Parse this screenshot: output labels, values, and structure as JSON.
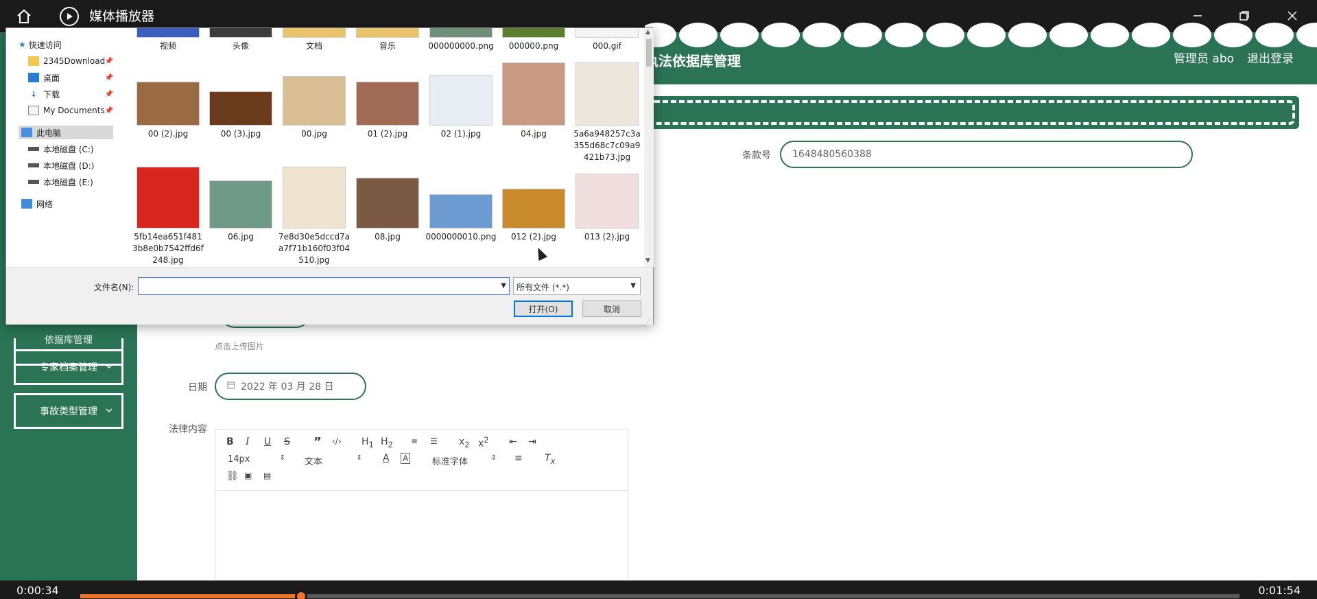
{
  "player": {
    "title": "媒体播放器",
    "time_current": "0:00:34",
    "time_total": "0:01:54",
    "progress_fraction": 0.1905
  },
  "app": {
    "title_partial": "执法依据库管理",
    "user": "管理员 abo",
    "logout": "退出登录",
    "sidebar": [
      {
        "label": "依据库管理",
        "has_chevron": false
      },
      {
        "label": "专家档案管理",
        "has_chevron": true
      },
      {
        "label": "事故类型管理",
        "has_chevron": true
      }
    ],
    "form": {
      "clause_label": "条款号",
      "clause_value": "1648480560388",
      "upload_hint": "点击上传图片",
      "date_label": "日期",
      "date_value": "2022 年 03 月 28 日",
      "content_label": "法律内容"
    },
    "editor": {
      "font_size": "14px",
      "block_type": "文本",
      "font_family": "标准字体"
    }
  },
  "dialog": {
    "nav": {
      "quick_access": "快速访问",
      "pinned": [
        "2345Download",
        "桌面",
        "下载",
        "My Documents"
      ],
      "this_pc": "此电脑",
      "drives": [
        "本地磁盘 (C:)",
        "本地磁盘 (D:)",
        "本地磁盘 (E:)"
      ],
      "network": "网络"
    },
    "rows": [
      [
        {
          "name": "视频",
          "color": "#3b5fbf"
        },
        {
          "name": "头像",
          "color": "#3d3d3d"
        },
        {
          "name": "文档",
          "color": "#e8c46a"
        },
        {
          "name": "音乐",
          "color": "#e8c46a"
        },
        {
          "name": "000000000.png",
          "color": "#6f8f7a"
        },
        {
          "name": "000000.png",
          "color": "#5c7f2d"
        },
        {
          "name": "000.gif",
          "color": "#f4f4f4"
        }
      ],
      [
        {
          "name": "00 (2).jpg",
          "color": "#9a6a44"
        },
        {
          "name": "00 (3).jpg",
          "color": "#6a3a1c"
        },
        {
          "name": "00.jpg",
          "color": "#d9bd94"
        },
        {
          "name": "01 (2).jpg",
          "color": "#a06b56"
        },
        {
          "name": "02 (1).jpg",
          "color": "#e7edf2"
        },
        {
          "name": "04.jpg",
          "color": "#c89a84"
        },
        {
          "name": "5a6a948257c3a355d68c7c09a9421b73.jpg",
          "color": "#ede6dc"
        }
      ],
      [
        {
          "name": "5fb14ea651f4813b8e0b7542ffd6f248.jpg",
          "color": "#d8251f"
        },
        {
          "name": "06.jpg",
          "color": "#6f9a8a"
        },
        {
          "name": "7e8d30e5dccd7aa7f71b160f03f04510.jpg",
          "color": "#efe4cf"
        },
        {
          "name": "08.jpg",
          "color": "#7a5a44"
        },
        {
          "name": "0000000010.png",
          "color": "#6c9bd2"
        },
        {
          "name": "012 (2).jpg",
          "color": "#c88a2c"
        },
        {
          "name": "013 (2).jpg",
          "color": "#f1dfe0"
        }
      ]
    ],
    "filename_label": "文件名(N):",
    "filename_value": "",
    "filetype": "所有文件 (*.*)",
    "open_label": "打开(O)",
    "cancel_label": "取消"
  }
}
